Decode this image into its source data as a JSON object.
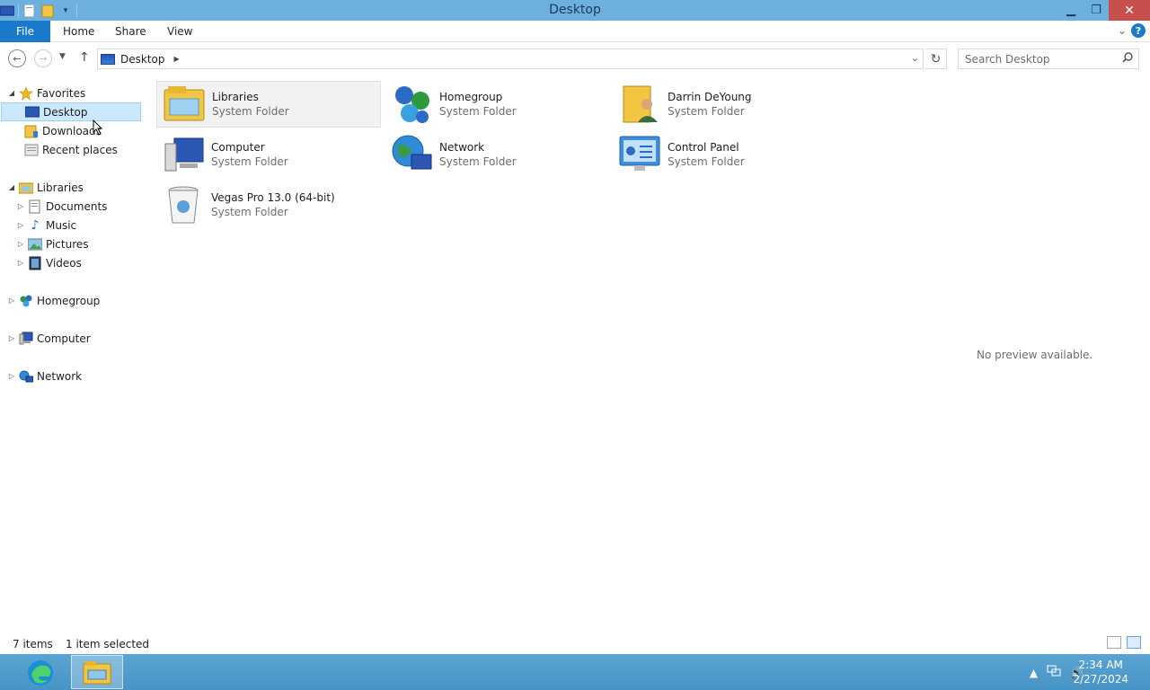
{
  "window": {
    "title": "Desktop"
  },
  "ribbon": {
    "file_label": "File",
    "tabs": [
      "Home",
      "Share",
      "View"
    ],
    "help": "?"
  },
  "address": {
    "crumb": "Desktop"
  },
  "search": {
    "placeholder": "Search Desktop"
  },
  "nav_tree": {
    "favorites": {
      "label": "Favorites",
      "items": [
        "Desktop",
        "Downloads",
        "Recent places"
      ]
    },
    "libraries": {
      "label": "Libraries",
      "items": [
        "Documents",
        "Music",
        "Pictures",
        "Videos"
      ]
    },
    "homegroup": "Homegroup",
    "computer": "Computer",
    "network": "Network"
  },
  "items": [
    {
      "name": "Libraries",
      "type": "System Folder"
    },
    {
      "name": "Homegroup",
      "type": "System Folder"
    },
    {
      "name": "Darrin DeYoung",
      "type": "System Folder"
    },
    {
      "name": "Computer",
      "type": "System Folder"
    },
    {
      "name": "Network",
      "type": "System Folder"
    },
    {
      "name": "Control Panel",
      "type": "System Folder"
    },
    {
      "name": "Vegas Pro 13.0 (64-bit)",
      "type": "System Folder"
    }
  ],
  "preview": "No preview available.",
  "status": {
    "count": "7 items",
    "selection": "1 item selected"
  },
  "taskbar": {
    "time": "2:34 AM",
    "date": "2/27/2024"
  }
}
